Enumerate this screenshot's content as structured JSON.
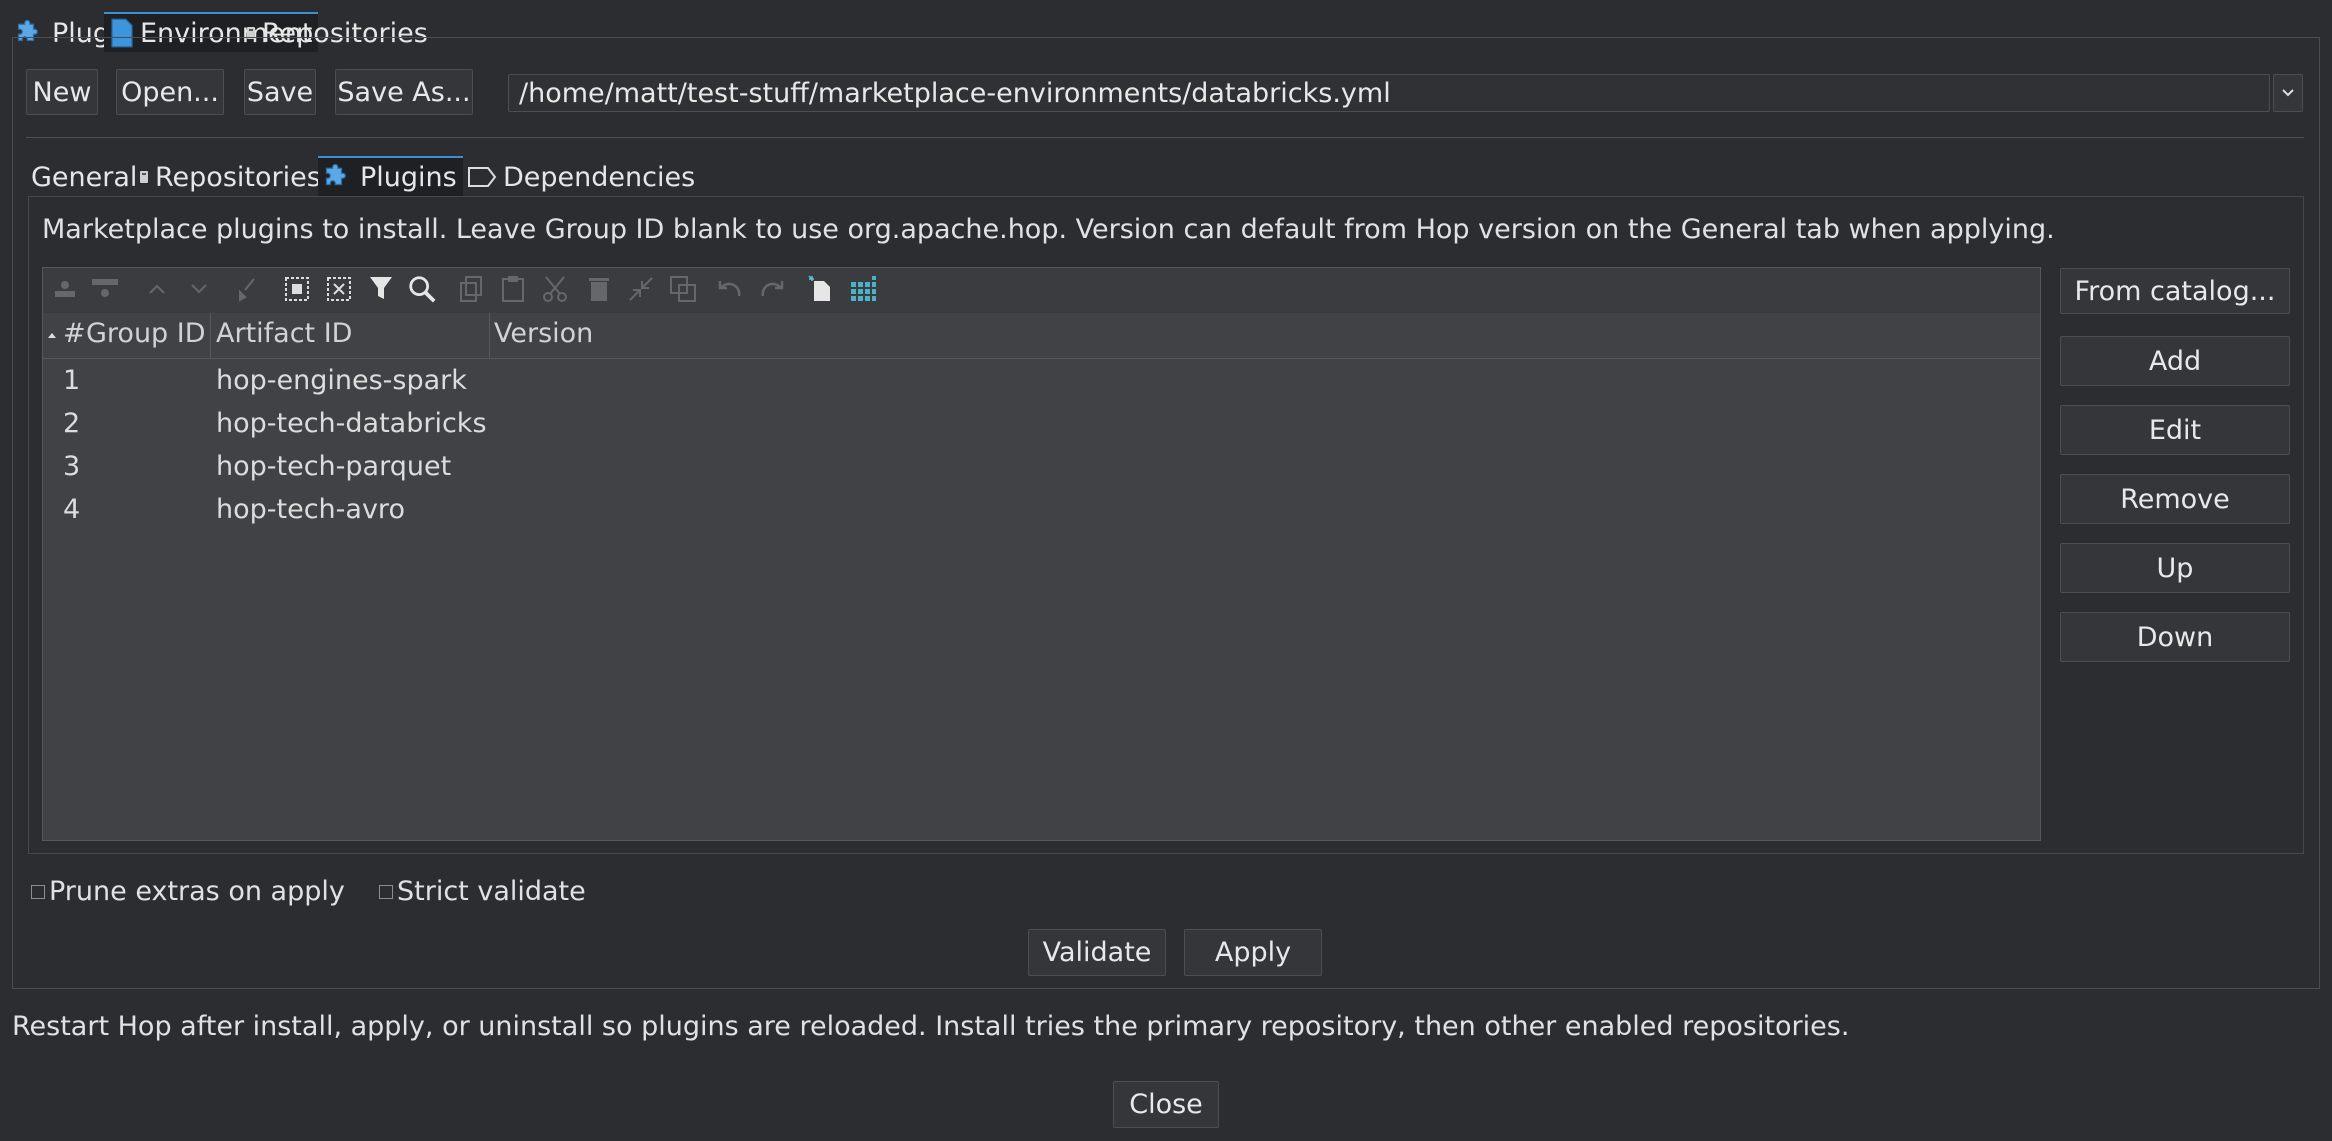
{
  "top_tabs": [
    {
      "label": "Plugins",
      "icon": "puzzle-icon"
    },
    {
      "label": "Environment",
      "icon": "document-icon",
      "active": true
    },
    {
      "label": "Repositories",
      "icon": "repository-icon"
    }
  ],
  "file_toolbar": {
    "new": "New",
    "open": "Open...",
    "save": "Save",
    "save_as": "Save As...",
    "path": "/home/matt/test-stuff/marketplace-environments/databricks.yml"
  },
  "inner_tabs": [
    {
      "label": "General"
    },
    {
      "label": "Repositories",
      "icon": "repository-icon"
    },
    {
      "label": "Plugins",
      "icon": "puzzle-icon",
      "active": true
    },
    {
      "label": "Dependencies",
      "icon": "tag-icon"
    }
  ],
  "description": "Marketplace plugins to install. Leave Group ID blank to use org.apache.hop. Version can default from Hop version on the General tab when applying.",
  "table": {
    "columns": [
      "#",
      "Group ID",
      "Artifact ID",
      "Version"
    ],
    "rows": [
      {
        "num": "1",
        "group": "",
        "artifact": "hop-engines-spark",
        "version": ""
      },
      {
        "num": "2",
        "group": "",
        "artifact": "hop-tech-databricks",
        "version": ""
      },
      {
        "num": "3",
        "group": "",
        "artifact": "hop-tech-parquet",
        "version": ""
      },
      {
        "num": "4",
        "group": "",
        "artifact": "hop-tech-avro",
        "version": ""
      }
    ]
  },
  "side_buttons": {
    "from_catalog": "From catalog...",
    "add": "Add",
    "edit": "Edit",
    "remove": "Remove",
    "up": "Up",
    "down": "Down"
  },
  "options": {
    "prune": "Prune extras on apply",
    "strict": "Strict validate"
  },
  "actions": {
    "validate": "Validate",
    "apply": "Apply"
  },
  "footer_note": "Restart Hop after install, apply, or uninstall so plugins are reloaded. Install tries the primary repository, then other enabled repositories.",
  "close": "Close",
  "colors": {
    "accent": "#3d8fd1",
    "background": "#2b2d30",
    "table_bg": "#404245"
  }
}
